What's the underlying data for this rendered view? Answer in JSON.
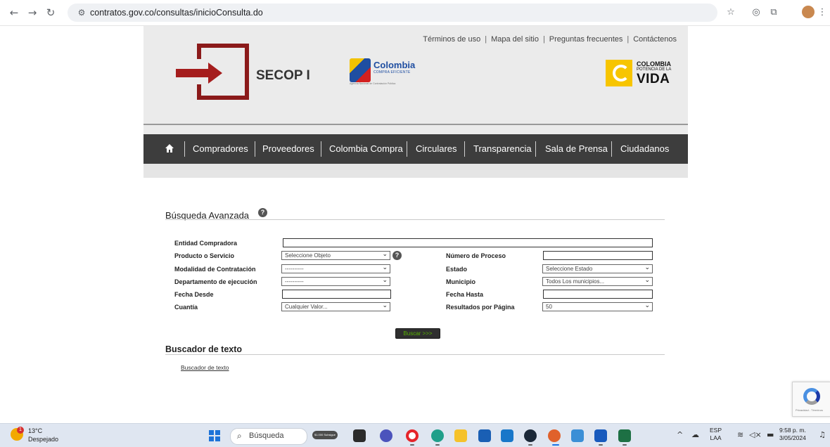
{
  "browser": {
    "url": "contratos.gov.co/consultas/inicioConsulta.do"
  },
  "header": {
    "top_links": [
      "Términos de uso",
      "Mapa del sitio",
      "Preguntas frecuentes",
      "Contáctenos"
    ],
    "site_title": "SECOP I",
    "cce_logo": {
      "name": "Colombia",
      "sub": "COMPRA EFICIENTE",
      "small": "Agencia Nacional de Contratación Pública"
    },
    "vida_logo": {
      "line1": "COLOMBIA",
      "line2": "POTENCIA DE LA",
      "line3": "VIDA"
    }
  },
  "nav": {
    "items": [
      "Compradores",
      "Proveedores",
      "Colombia Compra",
      "Circulares",
      "Transparencia",
      "Sala de Prensa",
      "Ciudadanos"
    ]
  },
  "search": {
    "title": "Búsqueda Avanzada",
    "fields": {
      "entidad_label": "Entidad Compradora",
      "producto_label": "Producto o Servicio",
      "producto_value": "Seleccione Objeto",
      "numero_label": "Número de Proceso",
      "modalidad_label": "Modalidad de Contratación",
      "modalidad_value": "----------",
      "estado_label": "Estado",
      "estado_value": "Seleccione Estado",
      "departamento_label": "Departamento de ejecución",
      "departamento_value": "----------",
      "municipio_label": "Municipio",
      "municipio_value": "Todos Los municipios...",
      "fecha_desde_label": "Fecha Desde",
      "fecha_hasta_label": "Fecha Hasta",
      "cuantia_label": "Cuantía",
      "cuantia_value": "Cualquier Valor...",
      "resultados_label": "Resultados por Página",
      "resultados_value": "50"
    },
    "button": "Buscar >>>"
  },
  "text_search": {
    "title": "Buscador de texto",
    "link": "Buscador de texto"
  },
  "recaptcha": {
    "text": "Privacidad - Términos"
  },
  "taskbar": {
    "weather_temp": "13°C",
    "weather_desc": "Despejado",
    "weather_badge": "1",
    "search_placeholder": "Búsqueda",
    "pill_text": "$1.000 Subsigue Ley",
    "lang_top": "ESP",
    "lang_bottom": "LAA",
    "time": "9:58 p. m.",
    "date": "3/05/2024"
  }
}
